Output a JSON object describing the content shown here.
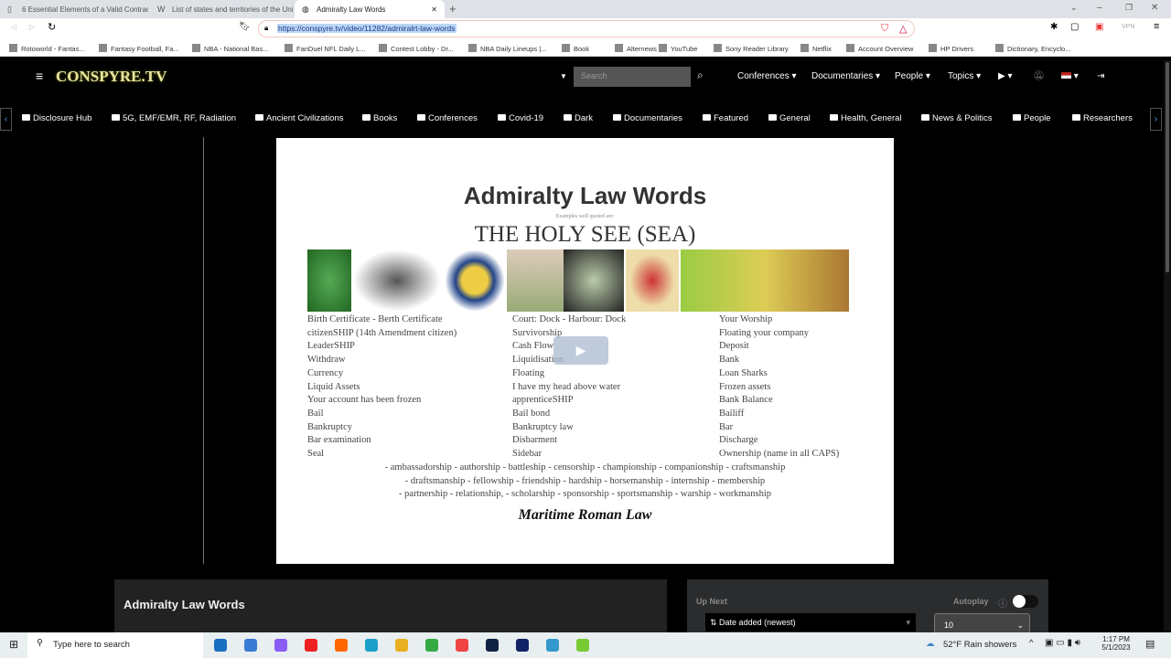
{
  "browser": {
    "tabs": [
      {
        "title": "6 Essential Elements of a Valid Contrac"
      },
      {
        "title": "List of states and territories of the Unit"
      },
      {
        "title": "Admiralty Law Words"
      }
    ],
    "url": "https://conspyre.tv/video/11282/admiralrt-law-words",
    "vpn": "VPN",
    "bookmarks": [
      "Rotoworld - Fantas...",
      "Fantasy Football, Fa...",
      "NBA - National Bas...",
      "FanDuel NFL Daily L...",
      "Contest Lobby - Dr...",
      "NBA Daily Lineups |...",
      "Book",
      "Alternews",
      "YouTube",
      "Sony Reader Library",
      "Netflix",
      "Account Overview",
      "HP Drivers",
      "Dictionary, Encyclo..."
    ]
  },
  "site": {
    "logo": "CONSPYRE.TV",
    "search_placeholder": "Search",
    "nav": [
      "Conferences",
      "Documentaries",
      "People",
      "Topics"
    ],
    "categories": [
      "Disclosure Hub",
      "5G, EMF/EMR, RF, Radiation",
      "Ancient Civilizations",
      "Books",
      "Conferences",
      "Covid-19",
      "Dark",
      "Documentaries",
      "Featured",
      "General",
      "Health, General",
      "News & Politics",
      "People",
      "Researchers"
    ]
  },
  "slide": {
    "title": "Admiralty Law Words",
    "subtitle": "Examples well quoted are:",
    "heading": "THE HOLY SEE (SEA)",
    "col1": [
      "Birth Certificate - Berth Certificate",
      "citizenSHIP (14th Amendment citizen)",
      "LeaderSHIP",
      "Withdraw",
      "Currency",
      "Liquid Assets",
      "Your account has been frozen",
      "Bail",
      "Bankruptcy",
      "Bar examination",
      "Seal"
    ],
    "col2": [
      "Court: Dock - Harbour: Dock",
      "Survivorship",
      "Cash Flow",
      "Liquidisation",
      "Floating",
      "I have my head above water",
      "apprenticeSHIP",
      "Bail bond",
      "Bankruptcy law",
      "Disbarment",
      "Sidebar"
    ],
    "col3": [
      "Your Worship",
      "Floating your company",
      "Deposit",
      "Bank",
      "Loan Sharks",
      "Frozen assets",
      "Bank Balance",
      "Bailiff",
      "Bar",
      "Discharge",
      "Ownership (name in all CAPS)"
    ],
    "ships": [
      "- ambassadorship - authorship - battleship - censorship - championship - companionship - craftsmanship",
      "- draftsmanship - fellowship - friendship - hardship - horsemanship - internship - membership",
      "- partnership - relationship, - scholarship - sponsorship - sportsmanship - warship - workmanship"
    ],
    "footer": "Maritime Roman Law"
  },
  "video_title": "Admiralty Law Words",
  "up_next": {
    "label": "Up Next",
    "autoplay": "Autoplay",
    "sort": "Date added (newest)",
    "count": "10"
  },
  "taskbar": {
    "search": "Type here to search",
    "weather": "52°F  Rain showers",
    "time": "1:17 PM",
    "date": "5/1/2023"
  }
}
